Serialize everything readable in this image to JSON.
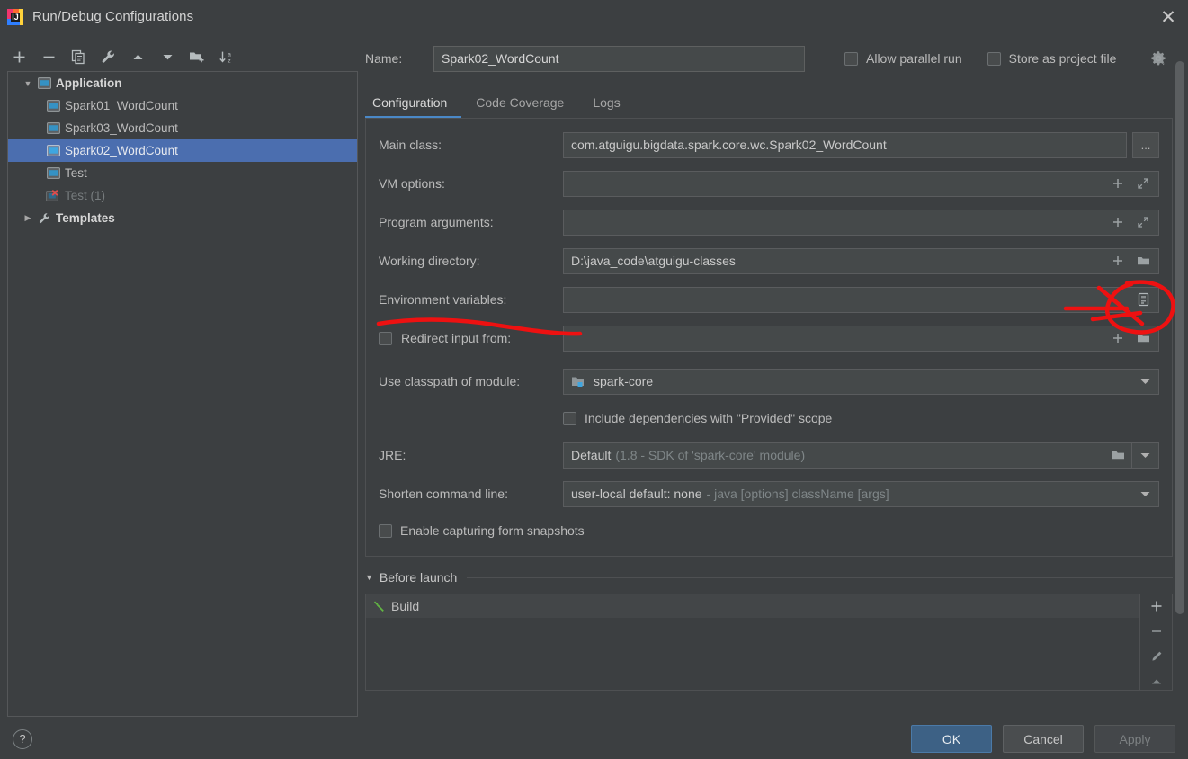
{
  "window": {
    "title": "Run/Debug Configurations",
    "app_icon": "intellij-idea-icon",
    "close_label": "✕"
  },
  "left_panel": {
    "toolbar": [
      {
        "name": "add-configuration-button",
        "icon": "plus-icon",
        "label": "+"
      },
      {
        "name": "remove-configuration-button",
        "icon": "minus-icon",
        "label": "−"
      },
      {
        "name": "copy-configuration-button",
        "icon": "copy-icon",
        "label": "Copy"
      },
      {
        "name": "edit-templates-button",
        "icon": "wrench-icon",
        "label": "Edit Templates"
      },
      {
        "name": "move-up-button",
        "icon": "arrow-up-icon",
        "label": "Move Up"
      },
      {
        "name": "move-down-button",
        "icon": "arrow-down-icon",
        "label": "Move Down"
      },
      {
        "name": "new-folder-button",
        "icon": "folder-add-icon",
        "label": "New Folder"
      },
      {
        "name": "sort-configurations-button",
        "icon": "sort-az-icon",
        "label": "Sort"
      }
    ],
    "tree": [
      {
        "label": "Application",
        "type": "group",
        "icon": "application-icon",
        "expanded": true,
        "selected": false,
        "disabled": false
      },
      {
        "label": "Spark01_WordCount",
        "type": "item",
        "icon": "application-icon",
        "selected": false,
        "disabled": false
      },
      {
        "label": "Spark03_WordCount",
        "type": "item",
        "icon": "application-icon",
        "selected": false,
        "disabled": false
      },
      {
        "label": "Spark02_WordCount",
        "type": "item",
        "icon": "application-icon",
        "selected": true,
        "disabled": false
      },
      {
        "label": "Test",
        "type": "item",
        "icon": "application-icon",
        "selected": false,
        "disabled": false
      },
      {
        "label": "Test (1)",
        "type": "item",
        "icon": "application-error-icon",
        "selected": false,
        "disabled": true
      },
      {
        "label": "Templates",
        "type": "group",
        "icon": "wrench-icon",
        "expanded": false,
        "selected": false,
        "disabled": false
      }
    ]
  },
  "header": {
    "name_label": "Name:",
    "name_value": "Spark02_WordCount",
    "allow_parallel_run_label": "Allow parallel run",
    "allow_parallel_run_checked": false,
    "store_as_project_file_label": "Store as project file",
    "store_as_project_file_checked": false,
    "gear_icon": "gear-dropdown-icon"
  },
  "tabs": [
    {
      "label": "Configuration",
      "active": true
    },
    {
      "label": "Code Coverage",
      "active": false
    },
    {
      "label": "Logs",
      "active": false
    }
  ],
  "configuration": {
    "main_class": {
      "label": "Main class:",
      "value": "com.atguigu.bigdata.spark.core.wc.Spark02_WordCount",
      "browse_label": "..."
    },
    "vm_options": {
      "label": "VM options:",
      "value": "",
      "adornments": [
        "plus-icon",
        "expand-icon"
      ]
    },
    "program_arguments": {
      "label": "Program arguments:",
      "value": "",
      "adornments": [
        "plus-icon",
        "expand-icon"
      ]
    },
    "working_directory": {
      "label": "Working directory:",
      "value": "D:\\java_code\\atguigu-classes",
      "adornments": [
        "plus-icon",
        "folder-icon"
      ]
    },
    "environment_variables": {
      "label": "Environment variables:",
      "value": "",
      "adornments": [
        "list-browse-icon"
      ]
    },
    "redirect_input": {
      "label": "Redirect input from:",
      "checked": false,
      "value": "",
      "adornments": [
        "plus-icon",
        "folder-icon"
      ]
    },
    "use_classpath_of_module": {
      "label": "Use classpath of module:",
      "value": "spark-core",
      "icon": "module-icon"
    },
    "include_provided_scope": {
      "label": "Include dependencies with \"Provided\" scope",
      "checked": false
    },
    "jre": {
      "label": "JRE:",
      "value": "Default",
      "value_hint": "(1.8 - SDK of 'spark-core' module)"
    },
    "shorten_command_line": {
      "label": "Shorten command line:",
      "value": "user-local default: none",
      "value_hint": "- java [options] className [args]"
    },
    "enable_form_snapshots": {
      "label": "Enable capturing form snapshots",
      "checked": false
    }
  },
  "before_launch": {
    "title": "Before launch",
    "expanded": true,
    "items": [
      {
        "label": "Build",
        "icon": "build-hammer-icon"
      }
    ],
    "side_buttons": [
      {
        "name": "before-launch-add-button",
        "icon": "plus-icon"
      },
      {
        "name": "before-launch-remove-button",
        "icon": "minus-icon"
      },
      {
        "name": "before-launch-edit-button",
        "icon": "pencil-icon"
      },
      {
        "name": "before-launch-move-up-button",
        "icon": "arrow-up-icon"
      }
    ]
  },
  "footer": {
    "help_label": "?",
    "ok_label": "OK",
    "cancel_label": "Cancel",
    "apply_label": "Apply",
    "apply_enabled": false
  },
  "annotations": {
    "color": "#ee1111",
    "marks": [
      {
        "name": "underline-environment-variables",
        "type": "underline"
      },
      {
        "name": "arrow-to-env-browse-button",
        "type": "arrow"
      },
      {
        "name": "circle-env-browse-button",
        "type": "circle"
      }
    ]
  },
  "colors": {
    "background": "#3c3f41",
    "field_background": "#45494a",
    "selection": "#4b6eaf",
    "accent": "#4a88c7",
    "annotation_red": "#ee1111",
    "text": "#bbbbbb"
  }
}
